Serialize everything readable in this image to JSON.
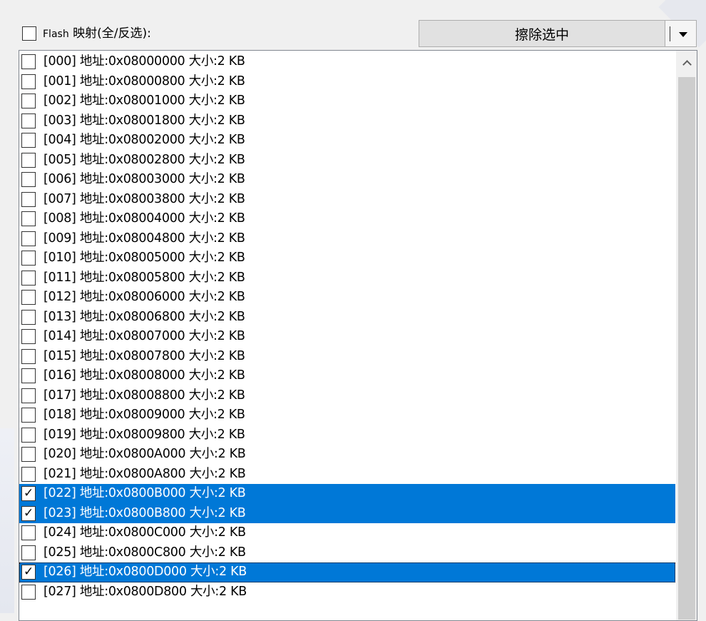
{
  "header": {
    "select_all_prefix": "Flash",
    "select_all_label": " 映射(全/反选):",
    "select_all_checked": false
  },
  "toolbar": {
    "erase_label": "擦除选中",
    "dropdown_icon": "chevron-down-icon"
  },
  "list": {
    "items": [
      {
        "label": "[000] 地址:0x08000000 大小:2 KB",
        "checked": false,
        "selected": false
      },
      {
        "label": "[001] 地址:0x08000800 大小:2 KB",
        "checked": false,
        "selected": false
      },
      {
        "label": "[002] 地址:0x08001000 大小:2 KB",
        "checked": false,
        "selected": false
      },
      {
        "label": "[003] 地址:0x08001800 大小:2 KB",
        "checked": false,
        "selected": false
      },
      {
        "label": "[004] 地址:0x08002000 大小:2 KB",
        "checked": false,
        "selected": false
      },
      {
        "label": "[005] 地址:0x08002800 大小:2 KB",
        "checked": false,
        "selected": false
      },
      {
        "label": "[006] 地址:0x08003000 大小:2 KB",
        "checked": false,
        "selected": false
      },
      {
        "label": "[007] 地址:0x08003800 大小:2 KB",
        "checked": false,
        "selected": false
      },
      {
        "label": "[008] 地址:0x08004000 大小:2 KB",
        "checked": false,
        "selected": false
      },
      {
        "label": "[009] 地址:0x08004800 大小:2 KB",
        "checked": false,
        "selected": false
      },
      {
        "label": "[010] 地址:0x08005000 大小:2 KB",
        "checked": false,
        "selected": false
      },
      {
        "label": "[011] 地址:0x08005800 大小:2 KB",
        "checked": false,
        "selected": false
      },
      {
        "label": "[012] 地址:0x08006000 大小:2 KB",
        "checked": false,
        "selected": false
      },
      {
        "label": "[013] 地址:0x08006800 大小:2 KB",
        "checked": false,
        "selected": false
      },
      {
        "label": "[014] 地址:0x08007000 大小:2 KB",
        "checked": false,
        "selected": false
      },
      {
        "label": "[015] 地址:0x08007800 大小:2 KB",
        "checked": false,
        "selected": false
      },
      {
        "label": "[016] 地址:0x08008000 大小:2 KB",
        "checked": false,
        "selected": false
      },
      {
        "label": "[017] 地址:0x08008800 大小:2 KB",
        "checked": false,
        "selected": false
      },
      {
        "label": "[018] 地址:0x08009000 大小:2 KB",
        "checked": false,
        "selected": false
      },
      {
        "label": "[019] 地址:0x08009800 大小:2 KB",
        "checked": false,
        "selected": false
      },
      {
        "label": "[020] 地址:0x0800A000 大小:2 KB",
        "checked": false,
        "selected": false
      },
      {
        "label": "[021] 地址:0x0800A800 大小:2 KB",
        "checked": false,
        "selected": false
      },
      {
        "label": "[022] 地址:0x0800B000 大小:2 KB",
        "checked": true,
        "selected": true
      },
      {
        "label": "[023] 地址:0x0800B800 大小:2 KB",
        "checked": true,
        "selected": true
      },
      {
        "label": "[024] 地址:0x0800C000 大小:2 KB",
        "checked": false,
        "selected": false
      },
      {
        "label": "[025] 地址:0x0800C800 大小:2 KB",
        "checked": false,
        "selected": false
      },
      {
        "label": "[026] 地址:0x0800D000 大小:2 KB",
        "checked": true,
        "selected": true,
        "focused": true
      },
      {
        "label": "[027] 地址:0x0800D800 大小:2 KB",
        "checked": false,
        "selected": false
      }
    ]
  },
  "scrollbar": {
    "up_icon": "chevron-up-icon"
  },
  "colors": {
    "selection": "#0078d7",
    "window": "#f0f0f0",
    "button": "#e1e1e1"
  }
}
